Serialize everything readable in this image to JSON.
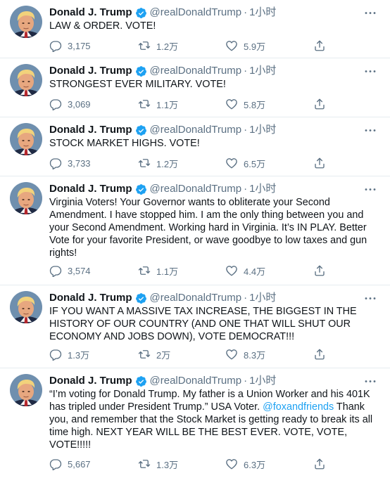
{
  "author": {
    "name": "Donald J. Trump",
    "handle": "@realDonaldTrump",
    "separator": "·"
  },
  "colors": {
    "verified_badge": "#1da1f2",
    "secondary_text": "#5b7083",
    "link": "#1da1f2",
    "divider": "#e6ecf0"
  },
  "icons": {
    "reply": "reply-icon",
    "retweet": "retweet-icon",
    "like": "heart-icon",
    "share": "share-icon",
    "more": "more-options-icon",
    "verified": "verified-badge-icon"
  },
  "tweets": [
    {
      "time": "1小时",
      "text": "LAW & ORDER. VOTE!",
      "replies": "3,175",
      "retweets": "1.2万",
      "likes": "5.9万"
    },
    {
      "time": "1小时",
      "text": "STRONGEST EVER MILITARY. VOTE!",
      "replies": "3,069",
      "retweets": "1.1万",
      "likes": "5.8万"
    },
    {
      "time": "1小时",
      "text": "STOCK MARKET HIGHS. VOTE!",
      "replies": "3,733",
      "retweets": "1.2万",
      "likes": "6.5万"
    },
    {
      "time": "1小时",
      "text": "Virginia Voters! Your Governor wants to obliterate your Second Amendment. I have stopped him. I am the only thing between you and your Second Amendment. Working hard in Virginia. It’s IN PLAY. Better Vote for your favorite President, or wave goodbye to low taxes and gun rights!",
      "replies": "3,574",
      "retweets": "1.1万",
      "likes": "4.4万"
    },
    {
      "time": "1小时",
      "text": "IF YOU WANT A MASSIVE TAX INCREASE, THE BIGGEST IN THE HISTORY OF OUR COUNTRY (AND ONE THAT WILL SHUT OUR ECONOMY AND JOBS DOWN), VOTE DEMOCRAT!!!",
      "replies": "1.3万",
      "retweets": "2万",
      "likes": "8.3万"
    },
    {
      "time": "1小时",
      "text_before_link": "“I’m voting for Donald Trump. My father is a Union Worker and his 401K has tripled under President Trump.” USA Voter. ",
      "link": "@foxandfriends",
      "text_after_link": " Thank you, and remember that the Stock Market is getting ready to break its all time high. NEXT YEAR WILL BE THE BEST EVER. VOTE, VOTE, VOTE!!!!!",
      "replies": "5,667",
      "retweets": "1.3万",
      "likes": "6.3万"
    }
  ]
}
